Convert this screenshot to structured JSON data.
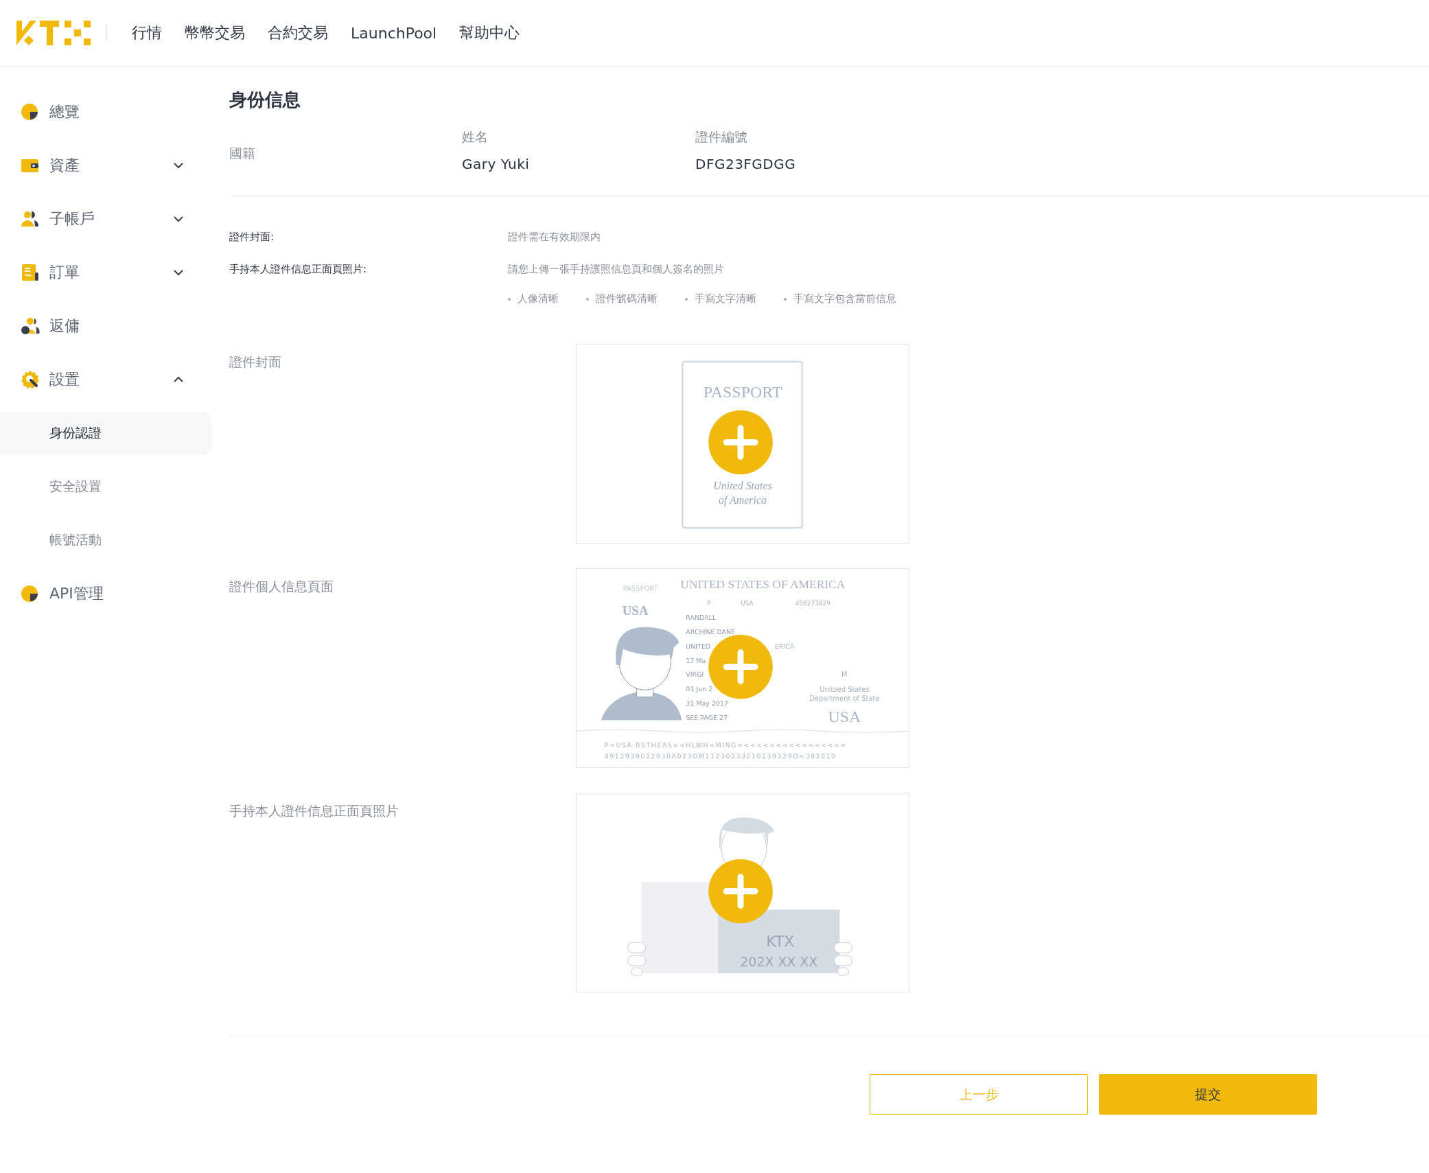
{
  "header": {
    "nav": [
      "行情",
      "幣幣交易",
      "合約交易",
      "LaunchPool",
      "幫助中心"
    ]
  },
  "sidebar": {
    "items": [
      {
        "label": "總覽",
        "kind": "link"
      },
      {
        "label": "資產",
        "kind": "group",
        "expanded": false
      },
      {
        "label": "子帳戶",
        "kind": "group",
        "expanded": false
      },
      {
        "label": "訂單",
        "kind": "group",
        "expanded": false
      },
      {
        "label": "返傭",
        "kind": "link"
      },
      {
        "label": "設置",
        "kind": "group",
        "expanded": true,
        "children": [
          {
            "label": "身份認證",
            "selected": true
          },
          {
            "label": "安全設置",
            "selected": false
          },
          {
            "label": "帳號活動",
            "selected": false
          }
        ]
      },
      {
        "label": "API管理",
        "kind": "link"
      }
    ]
  },
  "page": {
    "title": "身份信息",
    "info": [
      {
        "label": "國籍"
      },
      {
        "label": "姓名",
        "value": "Gary Yuki"
      },
      {
        "label": "證件編號",
        "value": "DFG23FGDGG"
      }
    ],
    "requirements": [
      {
        "label": "證件封面:",
        "text": "證件需在有效期限内"
      },
      {
        "label": "手持本人證件信息正面頁照片:",
        "text": "請您上傳一張手持護照信息頁和個人簽名的照片"
      }
    ],
    "bullets": [
      "人像清晰",
      "證件號碼清晰",
      "手寫文字清晰",
      "手寫文字包含當前信息"
    ],
    "uploads": [
      {
        "label": "證件封面",
        "kind": "cover",
        "title": "PASSPORT",
        "lines": [
          "United States",
          "of America"
        ]
      },
      {
        "label": "證件個人信息頁面",
        "kind": "info_page",
        "heading": "UNITED STATES OF AMERICA",
        "side": [
          "PASSPORT",
          "USA"
        ],
        "top_fields": [
          "P",
          "USA",
          "456273829"
        ],
        "fields": [
          "RANDALL",
          "ARCHINE DANE",
          "UNITED",
          "17 Ma",
          "VIRGI",
          "01 Jun 2",
          "31 May 2017",
          "SEE PAGE 27"
        ],
        "fragment": "ERICA",
        "authority": [
          "M",
          "Unitsed States",
          "Department of State"
        ],
        "watermark": "USA",
        "mrz": [
          "P<USA RSTHEAS<<HLWH<MING<<<<<<<<<<<<<<<<<",
          "4912939012930A023OM11230233210139329O<392010"
        ]
      },
      {
        "label": "手持本人證件信息正面頁照片",
        "kind": "selfie",
        "sign": [
          "KTX",
          "202X XX XX"
        ]
      }
    ]
  },
  "buttons": [
    {
      "label": "上一步",
      "kind": "secondary"
    },
    {
      "label": "提交",
      "kind": "primary"
    }
  ]
}
